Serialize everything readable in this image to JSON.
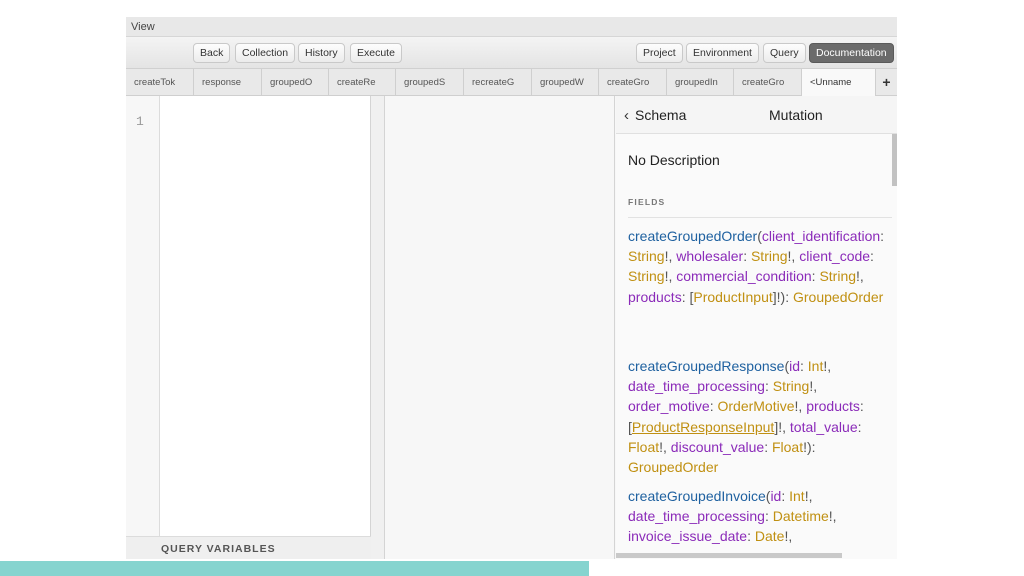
{
  "menu": {
    "view_label": "View"
  },
  "toolbar": {
    "back": "Back",
    "collection": "Collection",
    "history": "History",
    "execute": "Execute",
    "project": "Project",
    "environment": "Environment",
    "query": "Query",
    "documentation": "Documentation"
  },
  "tabs": [
    "createTok",
    "response",
    "groupedO",
    "createRe",
    "groupedS",
    "recreateG",
    "groupedW",
    "createGro",
    "groupedIn",
    "createGro",
    "<Unname"
  ],
  "editor": {
    "line_number": "1",
    "query_variables_label": "QUERY VARIABLES"
  },
  "docs": {
    "back_label": "Schema",
    "title": "Mutation",
    "description": "No Description",
    "fields_label": "FIELDS"
  },
  "colors": {
    "field_name": "#1f61a0",
    "arg_name": "#8b2bb9",
    "type_name": "#c09012",
    "accent_strip": "#86d4cf"
  },
  "icons": {
    "back": "chevron-left-icon",
    "add_tab": "plus-icon"
  }
}
